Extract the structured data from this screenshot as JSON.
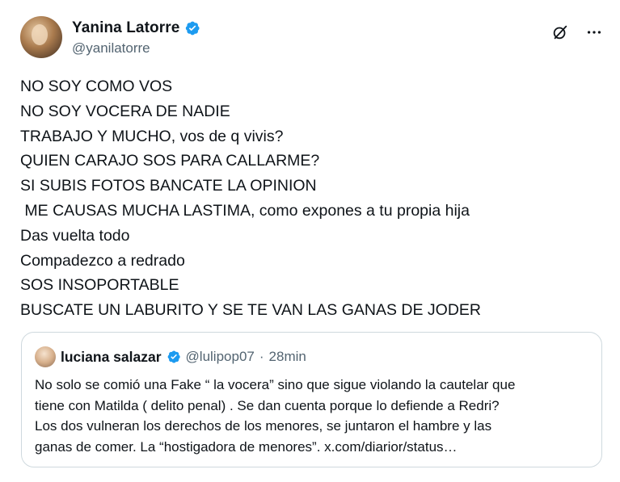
{
  "tweet": {
    "author": {
      "name": "Yanina Latorre",
      "handle": "@yanilatorre",
      "verified": true,
      "avatar_icon": "profile-photo"
    },
    "actions": {
      "grok_icon": "grok-icon",
      "more_icon": "more-icon"
    },
    "lines": [
      "NO SOY COMO VOS",
      "NO SOY VOCERA DE NADIE",
      "TRABAJO Y MUCHO, vos de q vivis?",
      "QUIEN CARAJO SOS PARA CALLARME?",
      "SI SUBIS FOTOS BANCATE LA OPINION",
      " ME CAUSAS MUCHA LASTIMA, como expones a tu propia hija",
      "Das vuelta todo",
      "Compadezco a redrado",
      "SOS INSOPORTABLE",
      "BUSCATE UN LABURITO Y SE TE VAN LAS GANAS DE JODER"
    ]
  },
  "quote": {
    "author": {
      "name": "luciana salazar",
      "handle": "@lulipop07",
      "separator": "·",
      "time": "28min",
      "verified": true
    },
    "text_lines": [
      "No solo se comió una Fake “ la vocera” sino que sigue violando la cautelar que",
      "tiene con Matilda ( delito penal) . Se dan cuenta porque lo defiende a Redri?",
      "Los dos vulneran los derechos de los menores, se juntaron el hambre y las",
      "ganas de comer. La “hostigadora de menores”. x.com/diarior/status…"
    ]
  },
  "colors": {
    "text": "#0f1419",
    "secondary": "#536471",
    "verified_blue": "#1d9bf0",
    "border": "#cfd9de"
  }
}
